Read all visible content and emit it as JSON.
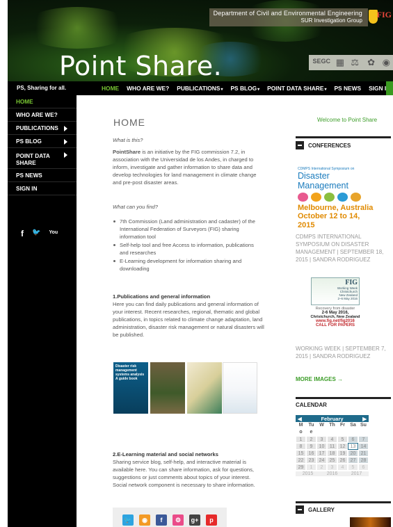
{
  "header": {
    "dept_line1": "Department of Civil and Environmental Engineering",
    "dept_line2": "SUR Investigation Group",
    "fig_logo": "FIG",
    "site_title": "Point Share.",
    "partner_segc": "SEGC"
  },
  "topbar": {
    "tagline": "PS, Sharing for all.",
    "nav": [
      {
        "label": "HOME",
        "caret": ""
      },
      {
        "label": "WHO ARE WE?",
        "caret": ""
      },
      {
        "label": "PUBLICATIONS",
        "caret": "▾"
      },
      {
        "label": "PS BLOG",
        "caret": "▾"
      },
      {
        "label": "POINT DATA SHARE",
        "caret": "▾"
      },
      {
        "label": "PS NEWS",
        "caret": ""
      },
      {
        "label": "SIGN IN",
        "caret": ""
      }
    ]
  },
  "sidebar": {
    "items": [
      {
        "label": "HOME"
      },
      {
        "label": "WHO ARE WE?"
      },
      {
        "label": "PUBLICATIONS"
      },
      {
        "label": "PS BLOG"
      },
      {
        "label": "POINT DATA SHARE"
      },
      {
        "label": "PS NEWS"
      },
      {
        "label": "SIGN IN"
      }
    ],
    "social": {
      "facebook": "f",
      "twitter": "🐦",
      "youtube": "You"
    }
  },
  "main": {
    "title": "HOME",
    "q1": "What is this?",
    "intro_strong": "PointShare",
    "intro_rest": " is an initiative by the FIG commission 7.2, in association with the Universidad de los Andes, in charged to inform, investigate and gather information to share data and develop technologies for land management in climate change and pre-post disaster areas.",
    "q2": "What can you find?",
    "bullets": [
      "7th Commission (Land administration and cadaster) of the International Federation of Surveyors (FIG) sharing information tool",
      "Self-help tool and free Access to information, publications and researches",
      "E-Learning development for information sharing and downloading"
    ],
    "sec1_title": "1.Publications and general information",
    "sec1_text": "Here you can find daily publications and general information of your interest. Recent researches, regional, thematic and global publications, in topics related to climate change adaptation, land administration, disaster risk management or natural disasters will be published.",
    "pub1_text": "Disaster risk management systems analysis A guide book",
    "sec2_title": "2.E-Learning material and social networks",
    "sec2_text": "Sharing service blog, self-help, and interactive material is available here. You can share information, ask for questions, suggestions or just comments about topics of your interest. Social network component is necessary to share information.",
    "share_icons": {
      "twitter": "🐦",
      "rss": "◉",
      "facebook": "f",
      "dribbble": "⚙",
      "gplus": "g+",
      "pinterest": "p"
    }
  },
  "right": {
    "welcome": "Welcome to Point Share",
    "conferences_title": "CONFERENCES",
    "conf_img": {
      "line1": "CDMPS International Symposium on",
      "line2": "Disaster Management",
      "city": "Melbourne, Australia",
      "date": "October 12 to 14, 2015"
    },
    "post1_caption": "CDMPS INTERNATIONAL SYMPOSIUM ON DISASTER MANAGEMENT | SEPTEMBER 18, 2015 | SANDRA RODRIGUEZ",
    "fig_img": {
      "fig": "FIG",
      "sub": "Working Week\nChristchurch\nNew Zealand\n2–6 May 2016",
      "recovery": "Recovery from disaster",
      "date": "2-6 May 2016,",
      "location": "Christchurch, New Zealand",
      "url": "www.fig.net/fig2016",
      "cfp": "CALL FOR PAPERS"
    },
    "post2_caption": "WORKING WEEK | SEPTEMBER 7, 2015 | SANDRA RODRIGUEZ",
    "more_images": "MORE IMAGES →",
    "calendar_title": "CALENDAR",
    "calendar": {
      "month": "February",
      "prev": "◀",
      "next": "▶",
      "weekdays": [
        "M",
        "Tu",
        "W",
        "Th",
        "Fr",
        "Sa",
        "Su"
      ],
      "rows": [
        [
          "o",
          "e",
          "",
          "",
          "",
          "",
          ""
        ],
        [
          "1",
          "2",
          "3",
          "4",
          "5",
          "6",
          "7"
        ],
        [
          "8",
          "9",
          "10",
          "11",
          "12",
          "13",
          "14"
        ],
        [
          "15",
          "16",
          "17",
          "18",
          "19",
          "20",
          "21"
        ],
        [
          "22",
          "23",
          "24",
          "25",
          "26",
          "27",
          "28"
        ],
        [
          "29",
          "1",
          "2",
          "3",
          "4",
          "5",
          "6"
        ]
      ],
      "years": [
        "2015",
        "2016",
        "2017"
      ]
    },
    "gallery_title": "GALLERY"
  },
  "colors": {
    "accent_green": "#79c733",
    "link_green": "#3c9d28",
    "calendar_blue": "#1f6b8b"
  }
}
